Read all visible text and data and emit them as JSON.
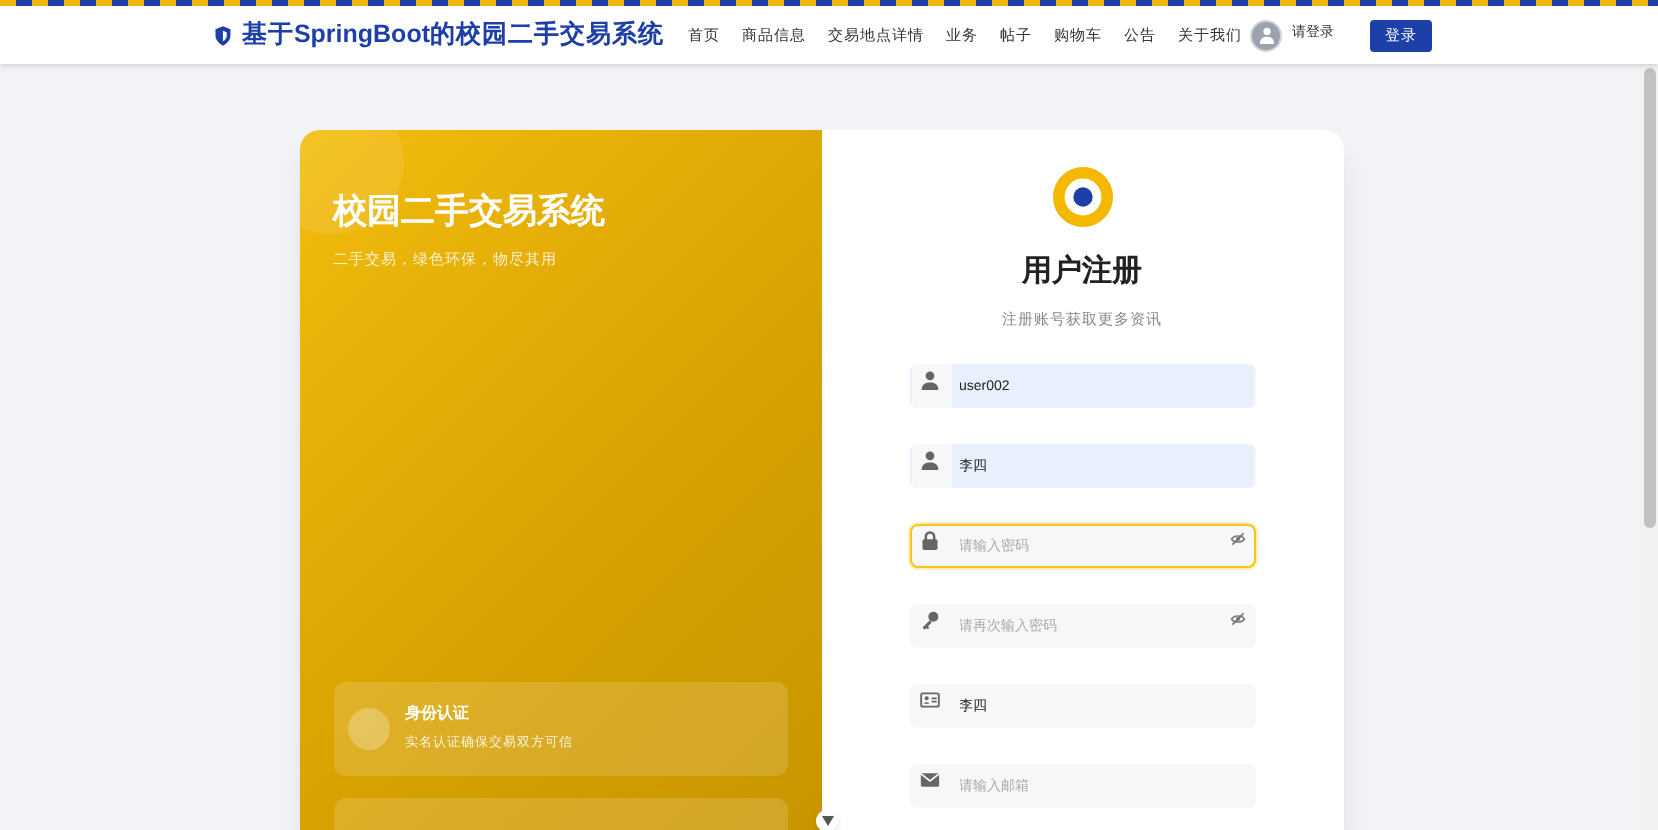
{
  "header": {
    "brand": "基于SpringBoot的校园二手交易系统",
    "nav": [
      "首页",
      "商品信息",
      "交易地点详情",
      "业务",
      "帖子",
      "购物车",
      "公告",
      "关于我们"
    ],
    "user_label": "请登录",
    "login_button": "登录"
  },
  "intro": {
    "title": "校园二手交易系统",
    "subtitle": "二手交易，绿色环保，物尽其用",
    "features": [
      {
        "title": "身份认证",
        "text": "实名认证确保交易双方可信"
      }
    ]
  },
  "form": {
    "title": "用户注册",
    "subtitle": "注册账号获取更多资讯",
    "fields": [
      {
        "kind": "user",
        "value": "user002",
        "autofilled": true,
        "focused": false
      },
      {
        "kind": "user",
        "value": "李四",
        "autofilled": true,
        "focused": false
      },
      {
        "kind": "password",
        "placeholder": "请输入密码",
        "autofilled": false,
        "focused": true
      },
      {
        "kind": "confirm",
        "placeholder": "请再次输入密码",
        "autofilled": false,
        "focused": false
      },
      {
        "kind": "idcard",
        "value": "李四",
        "autofilled": false,
        "focused": false
      },
      {
        "kind": "email",
        "placeholder": "请输入邮箱",
        "autofilled": false,
        "focused": false
      }
    ]
  }
}
